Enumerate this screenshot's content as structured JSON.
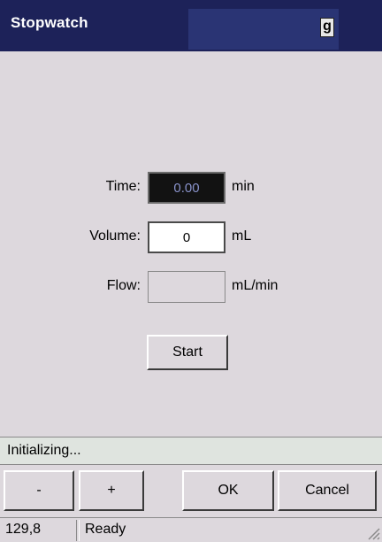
{
  "window": {
    "title": "Stopwatch",
    "title_indicator": "g",
    "colors": {
      "titlebar": "#1d2259",
      "background": "#ddd8dd",
      "time_field_bg": "#121212",
      "time_text": "#8891c9"
    }
  },
  "form": {
    "time": {
      "label": "Time:",
      "value": "0.00",
      "unit": "min"
    },
    "volume": {
      "label": "Volume:",
      "value": "0",
      "unit": "mL"
    },
    "flow": {
      "label": "Flow:",
      "value": "",
      "unit": "mL/min"
    },
    "start_label": "Start"
  },
  "status": {
    "message": "Initializing..."
  },
  "buttons": {
    "minus": "-",
    "plus": "+",
    "ok": "OK",
    "cancel": "Cancel"
  },
  "statusbar": {
    "coords": "129,8",
    "state": "Ready"
  },
  "icons": {
    "resize_grip": "resize-grip-icon"
  }
}
